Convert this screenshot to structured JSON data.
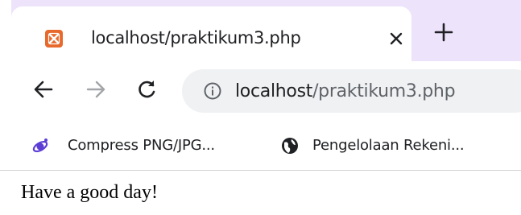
{
  "tab": {
    "title": "localhost/praktikum3.php",
    "favicon": "xampp-icon"
  },
  "toolbar": {
    "url_host": "localhost",
    "url_path": "/praktikum3.php"
  },
  "bookmarks": [
    {
      "label": "Compress PNG/JPG...",
      "icon": "compress-icon"
    },
    {
      "label": "Pengelolaan Rekeni...",
      "icon": "globe-icon"
    }
  ],
  "page": {
    "text": "Have a good day!"
  },
  "colors": {
    "tabstrip": "#ede3fb",
    "omnibox": "#f0f1f3",
    "favicon": "#e8692c",
    "bookmark_icon": "#5c3dd6"
  }
}
